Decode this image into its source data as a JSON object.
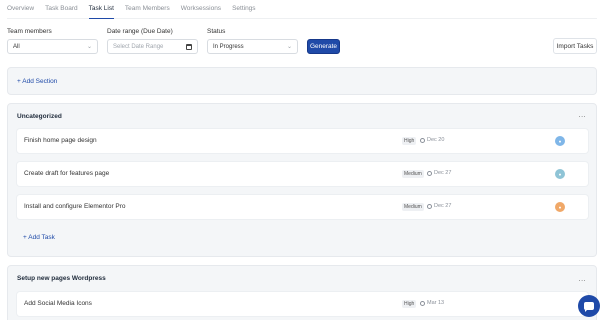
{
  "tabs": [
    {
      "label": "Overview",
      "active": false
    },
    {
      "label": "Task Board",
      "active": false
    },
    {
      "label": "Task List",
      "active": true
    },
    {
      "label": "Team Members",
      "active": false
    },
    {
      "label": "Worksessions",
      "active": false
    },
    {
      "label": "Settings",
      "active": false
    }
  ],
  "filters": {
    "team_members_label": "Team members",
    "team_members_value": "All",
    "date_range_label": "Date range (Due Date)",
    "date_range_placeholder": "Select Date Range",
    "status_label": "Status",
    "status_value": "In Progress",
    "generate_label": "Generate",
    "import_label": "Import Tasks"
  },
  "add_section_label": "+ Add Section",
  "sections": [
    {
      "title": "Uncategorized",
      "menu": "...",
      "add_task_label": "+ Add Task",
      "tasks": [
        {
          "title": "Finish home page design",
          "priority": "High",
          "due": "Dec 20",
          "avatar_color": "#7fb6e8"
        },
        {
          "title": "Create draft for features page",
          "priority": "Medium",
          "due": "Dec 27",
          "avatar_color": "#8fc4d6"
        },
        {
          "title": "Install and configure Elementor Pro",
          "priority": "Medium",
          "due": "Dec 27",
          "avatar_color": "#f0a868"
        }
      ]
    },
    {
      "title": "Setup new pages Wordpress",
      "menu": "...",
      "tasks": [
        {
          "title": "Add Social Media Icons",
          "priority": "High",
          "due": "Mar 13"
        }
      ]
    }
  ],
  "colors": {
    "accent": "#1f4aa8",
    "card_bg": "#f4f6f8"
  }
}
